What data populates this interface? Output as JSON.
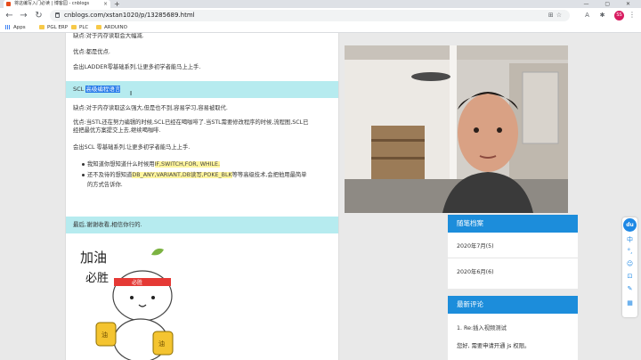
{
  "browser": {
    "tab_title": "将这编写入门必读 | 博客园 - cnblogs",
    "url": "cnblogs.com/xstan1020/p/13285689.html",
    "new_tab": "+",
    "window_controls": "— ▢ ✕",
    "profile_initials": "SS",
    "bookmarks": [
      {
        "label": "Apps",
        "icon": "apps-grid-icon"
      },
      {
        "label": "PGL ERP",
        "icon": "folder-icon"
      },
      {
        "label": "PLC",
        "icon": "folder-icon"
      },
      {
        "label": "ARDUINO",
        "icon": "folder-icon"
      }
    ]
  },
  "article": {
    "line_cons_top": "缺点:对于内存读取会大幅减.",
    "line_pros1": "优点:都是优点.",
    "line_ladder": "会出LADDER零基础系列,让更多初学者能马上上手.",
    "scl_heading_plain": "SCL ",
    "scl_heading_selected": "高级编程语言",
    "line_cons2": "缺点:对于内存读取这么强大,但是也不到,容易学习,容易被取代.",
    "line_pros2_a": "优点:当STL还在努力编辑的时候,SCL已经在喝咖啡了.当STL需要修改程序的时候,流程图,SCL已",
    "line_pros2_b": "经把最优方案提交上去,继续喝咖啡.",
    "line_scl_series": "会出SCL 零基础系列,让更多初学者能马上上手.",
    "bullet1_text": "我知道你想知道什么时候用",
    "bullet1_kw": "IF,SWITCH,FOR, WHILE.",
    "bullet2_text": "还不及待的想知道",
    "bullet2_kw": "DB_ANY,VARIANT,DB读写,POKE_BLK",
    "bullet2_rest": "等等高级技术,会把他用最简单",
    "bullet2_line2": "的方式告诉你.",
    "closing": "最后,谢谢收看,相信你行的.",
    "sticker_text_1": "加油",
    "sticker_text_2": "必胜",
    "sticker_headband": "必胜"
  },
  "sidebar": {
    "archive_title": "随笔档案",
    "archive_items": [
      "2020年7月(5)",
      "2020年6月(6)"
    ],
    "comments_title": "最新评论",
    "comment_1": "1. Re:插入视频测试",
    "comment_1_body": "您好, 需要申请开通 js 权限。"
  },
  "floatbar": {
    "logo": "du",
    "items": [
      "中",
      "°,",
      "☺",
      "⊡",
      "✎",
      "▦"
    ]
  },
  "colors": {
    "heading_bg": "#b6ebef",
    "sidebar_head": "#1c8ddb",
    "keyword_bg": "#fff59d",
    "selection": "#1a73e8"
  }
}
